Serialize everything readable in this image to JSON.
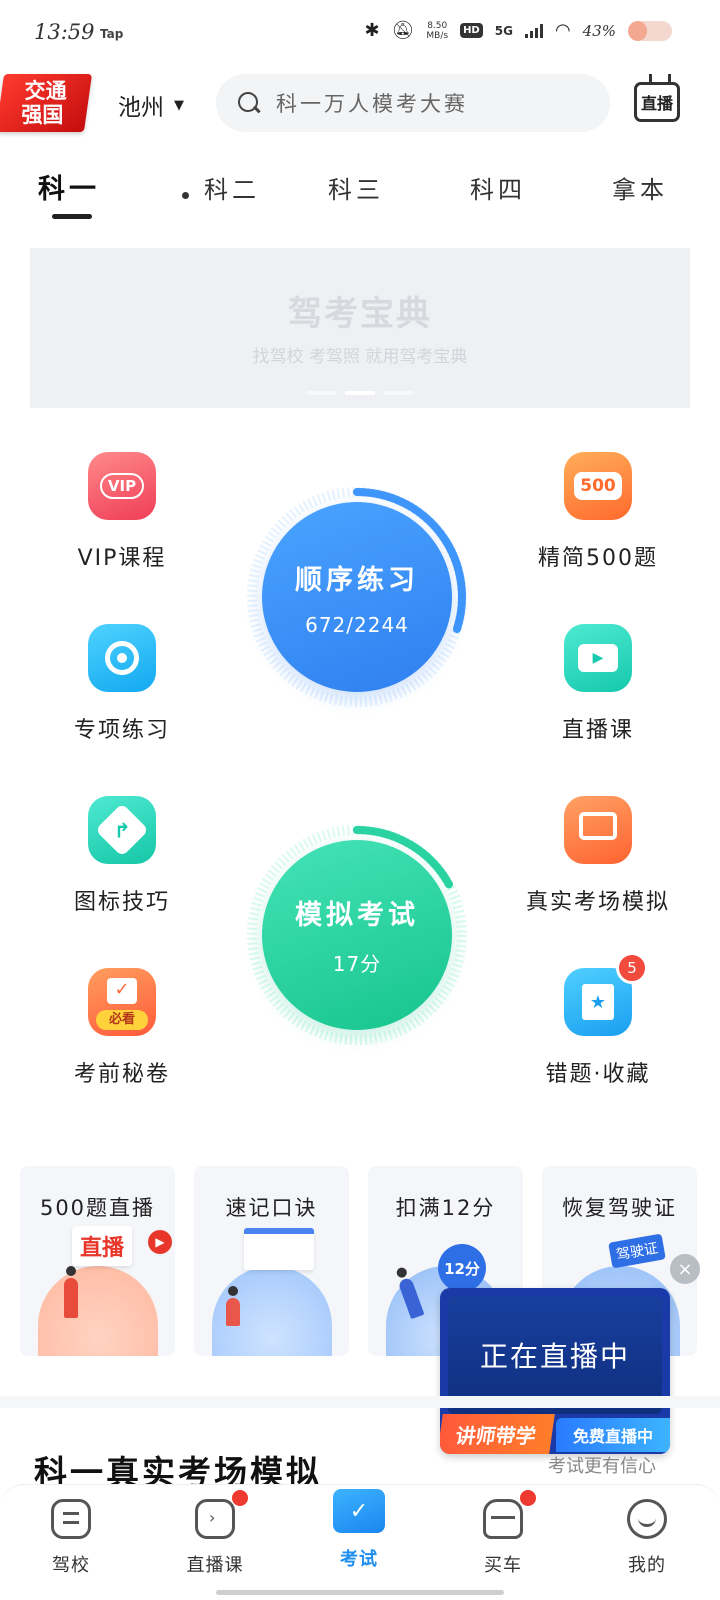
{
  "status_bar": {
    "time": "13:59",
    "tap": "Tap",
    "speed": "8.50\nMB/s",
    "hd": "HD",
    "network": "5G",
    "battery_percent": "43%",
    "battery_level": 0.43
  },
  "header": {
    "logo_line1": "交通",
    "logo_line2": "强国",
    "city": "池州",
    "search_placeholder": "科一万人模考大赛",
    "live_label": "直播"
  },
  "tabs": [
    {
      "label": "科一",
      "active": true
    },
    {
      "label": "科二",
      "active": false
    },
    {
      "label": "科三",
      "active": false
    },
    {
      "label": "科四",
      "active": false
    },
    {
      "label": "拿本",
      "active": false
    }
  ],
  "banner": {
    "title": "驾考宝典",
    "subtitle": "找驾校 考驾照 就用驾考宝典"
  },
  "features": {
    "vip": {
      "label": "VIP课程",
      "icon": "vip-icon",
      "icon_text": "VIP"
    },
    "jingjian": {
      "label": "精简500题",
      "icon": "500-icon",
      "icon_text": "500"
    },
    "special": {
      "label": "专项练习",
      "icon": "target-icon"
    },
    "live_course": {
      "label": "直播课",
      "icon": "video-icon"
    },
    "signs": {
      "label": "图标技巧",
      "icon": "turn-sign-icon"
    },
    "real_exam": {
      "label": "真实考场模拟",
      "icon": "monitor-icon"
    },
    "secret": {
      "label": "考前秘卷",
      "icon": "secret-volume-icon",
      "icon_text": "必看"
    },
    "wrong": {
      "label": "错题·收藏",
      "icon": "bookmark-star-icon",
      "badge": "5"
    }
  },
  "practice": {
    "sequential": {
      "title": "顺序练习",
      "progress_text": "672/2244",
      "done": 672,
      "total": 2244
    },
    "mock": {
      "title": "模拟考试",
      "score_text": "17分",
      "score": 17,
      "max": 100
    }
  },
  "promos": [
    {
      "title": "500题直播",
      "art_tag": "直播"
    },
    {
      "title": "速记口诀"
    },
    {
      "title": "扣满12分",
      "art_tag": "12分"
    },
    {
      "title": "恢复驾驶证",
      "art_tag": "驾驶证"
    }
  ],
  "floating_live": {
    "title": "正在直播中",
    "tag_left": "讲师带学",
    "tag_right": "免费直播中",
    "close": "×"
  },
  "section": {
    "title": "科一真实考场模拟",
    "right_text": "考试更有信心"
  },
  "nav": [
    {
      "label": "驾校",
      "icon": "driving-school-icon",
      "dot": false,
      "active": false
    },
    {
      "label": "直播课",
      "icon": "tv-icon",
      "dot": true,
      "active": false
    },
    {
      "label": "考试",
      "icon": "exam-folder-icon",
      "dot": false,
      "active": true
    },
    {
      "label": "买车",
      "icon": "car-icon",
      "dot": true,
      "active": false
    },
    {
      "label": "我的",
      "icon": "smile-icon",
      "dot": false,
      "active": false
    }
  ],
  "colors": {
    "accent_blue": "#2f7ff0",
    "accent_green": "#17c48c",
    "nav_active": "#1e8ef0",
    "badge_red": "#f24a3c"
  }
}
